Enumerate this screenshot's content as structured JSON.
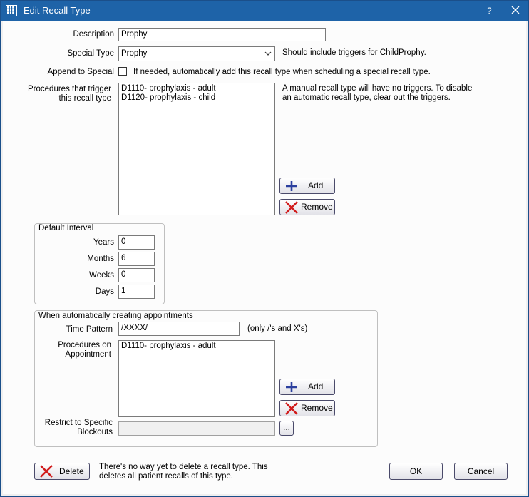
{
  "window": {
    "title": "Edit Recall Type",
    "help": "?",
    "app_icon": "grid-icon",
    "close_icon": "close-icon"
  },
  "description": {
    "label": "Description",
    "value": "Prophy"
  },
  "special_type": {
    "label": "Special Type",
    "value": "Prophy",
    "hint": "Should include triggers for ChildProphy."
  },
  "append_to_special": {
    "label": "Append to Special",
    "checked": false,
    "text": "If needed, automatically add this recall type when scheduling a special recall type."
  },
  "triggers": {
    "label_line1": "Procedures that trigger",
    "label_line2": "this recall type",
    "items": [
      "D1110- prophylaxis - adult",
      "D1120- prophylaxis - child"
    ],
    "note_line1": "A manual recall type will have no triggers.  To disable",
    "note_line2": "an automatic recall type, clear out the triggers.",
    "add_label": "Add",
    "remove_label": "Remove"
  },
  "default_interval": {
    "title": "Default Interval",
    "years_label": "Years",
    "years": "0",
    "months_label": "Months",
    "months": "6",
    "weeks_label": "Weeks",
    "weeks": "0",
    "days_label": "Days",
    "days": "1"
  },
  "appointments": {
    "title": "When automatically creating appointments",
    "time_pattern_label": "Time Pattern",
    "time_pattern": "/XXXX/",
    "time_pattern_hint": "(only /'s and X's)",
    "procedures_label_line1": "Procedures on",
    "procedures_label_line2": "Appointment",
    "procedures": [
      "D1110- prophylaxis - adult"
    ],
    "add_label": "Add",
    "remove_label": "Remove",
    "blockouts_label_line1": "Restrict to Specific",
    "blockouts_label_line2": "Blockouts",
    "blockouts_value": "",
    "browse_label": "..."
  },
  "footer": {
    "delete_label": "Delete",
    "delete_note_line1": "There's no way yet to delete a recall type.  This",
    "delete_note_line2": "deletes all patient recalls of this type.",
    "ok_label": "OK",
    "cancel_label": "Cancel"
  },
  "colors": {
    "titlebar": "#1e63a8",
    "add_icon": "#2b3f9e",
    "remove_icon": "#d11a1a"
  }
}
